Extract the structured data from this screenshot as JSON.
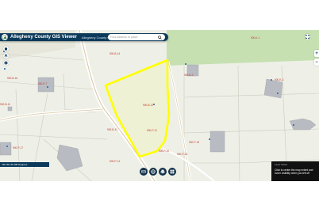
{
  "app": {
    "title": "Allegheny County GIS Viewer",
    "subtitle": "Allegheny County GIS Team"
  },
  "search": {
    "placeholder": "Find address or place"
  },
  "coords": {
    "text": "-80.162 40.498 Degrees"
  },
  "popup": {
    "title": "Layer Notes",
    "text": "Click to center the map extent and hover visibility when you left off"
  },
  "parcel_labels": [
    "900-B-14",
    "900-K-1",
    "900-B-14",
    "900-K-2",
    "900-B-12",
    "900-K-3",
    "900-B-16",
    "900-P-7",
    "900-B-11",
    "900-P-11",
    "900-P-14",
    "900-P-15",
    "900-P-17",
    "900-P-13",
    "900-P-10",
    "900-B-11"
  ],
  "colors": {
    "highlight": "#ffff00",
    "header": "#0c3a5b",
    "map_bg": "#eef0e7",
    "park": "#c6e0b2"
  },
  "toolbar": {
    "expand_icon": "expand-icon",
    "home_icon": "home-icon",
    "layers_icon": "layers-icon",
    "print_icon": "print-icon",
    "measure_icon": "measure-icon",
    "grid_icon": "grid-icon"
  }
}
